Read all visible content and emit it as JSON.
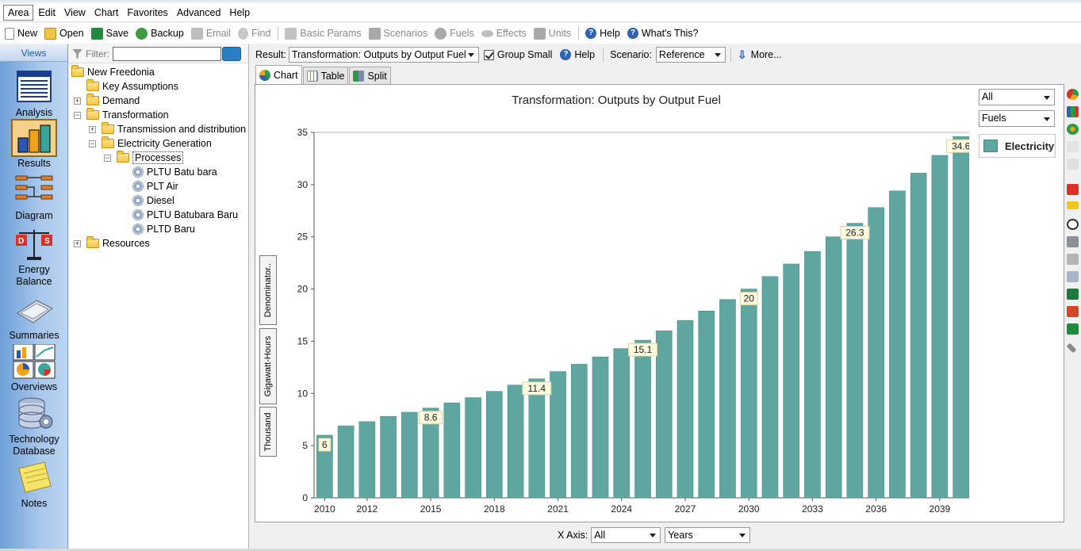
{
  "menu": [
    "Area",
    "Edit",
    "View",
    "Chart",
    "Favorites",
    "Advanced",
    "Help"
  ],
  "toolbar": {
    "new": "New",
    "open": "Open",
    "save": "Save",
    "backup": "Backup",
    "email": "Email",
    "find": "Find",
    "basic_params": "Basic Params",
    "scenarios": "Scenarios",
    "fuels": "Fuels",
    "effects": "Effects",
    "units": "Units",
    "help": "Help",
    "whats_this": "What's This?"
  },
  "views": {
    "header": "Views",
    "items": [
      "Analysis",
      "Results",
      "Diagram",
      "Energy Balance",
      "Summaries",
      "Overviews",
      "Technology Database",
      "Notes"
    ],
    "selected": "Results"
  },
  "filter": {
    "label": "Filter:",
    "value": ""
  },
  "tree": [
    {
      "label": "New Freedonia"
    },
    {
      "label": "Key Assumptions"
    },
    {
      "label": "Demand"
    },
    {
      "label": "Transformation"
    },
    {
      "label": "Transmission and distribution"
    },
    {
      "label": "Electricity Generation"
    },
    {
      "label": "Processes"
    },
    {
      "label": "PLTU Batu bara"
    },
    {
      "label": "PLT Air"
    },
    {
      "label": "Diesel"
    },
    {
      "label": "PLTU Batubara Baru"
    },
    {
      "label": "PLTD Baru"
    },
    {
      "label": "Resources"
    }
  ],
  "result_bar": {
    "result_label": "Result:",
    "result_value": "Transformation: Outputs by Output Fuel",
    "group_small": "Group Small",
    "help": "Help",
    "scenario_label": "Scenario:",
    "scenario_value": "Reference",
    "more": "More..."
  },
  "tabs": [
    "Chart",
    "Table",
    "Split"
  ],
  "side_buttons": [
    "Denominator..",
    "Gigawatt-Hours",
    "Thousand"
  ],
  "selectors": {
    "branch": "All",
    "dimension": "Fuels"
  },
  "x_axis_bar": {
    "label": "X Axis:",
    "value": "All",
    "unit": "Years"
  },
  "colors": {
    "bar": "#5fa5a0",
    "bar_stroke": "#4e928d",
    "label_bg": "#fdfbe0"
  },
  "chart_data": {
    "type": "bar",
    "title": "Transformation: Outputs by Output Fuel",
    "ylim": [
      0,
      35
    ],
    "yticks": [
      0,
      5,
      10,
      15,
      20,
      25,
      30,
      35
    ],
    "x": [
      2010,
      2011,
      2012,
      2013,
      2014,
      2015,
      2016,
      2017,
      2018,
      2019,
      2020,
      2021,
      2022,
      2023,
      2024,
      2025,
      2026,
      2027,
      2028,
      2029,
      2030,
      2031,
      2032,
      2033,
      2034,
      2035,
      2036,
      2037,
      2038,
      2039,
      2040
    ],
    "xtick_labels": [
      "2010",
      "2012",
      "2015",
      "2018",
      "2021",
      "2024",
      "2027",
      "2030",
      "2033",
      "2036",
      "2039"
    ],
    "xtick_years": [
      2010,
      2012,
      2015,
      2018,
      2021,
      2024,
      2027,
      2030,
      2033,
      2036,
      2039
    ],
    "series": [
      {
        "name": "Electricity",
        "values": [
          6.0,
          6.9,
          7.3,
          7.8,
          8.2,
          8.6,
          9.1,
          9.6,
          10.2,
          10.8,
          11.4,
          12.1,
          12.8,
          13.5,
          14.3,
          15.1,
          16.0,
          17.0,
          17.9,
          19.0,
          20.0,
          21.2,
          22.4,
          23.6,
          25.0,
          26.3,
          27.8,
          29.4,
          31.1,
          32.8,
          34.6
        ]
      }
    ],
    "data_labels": [
      {
        "year": 2010,
        "text": "6"
      },
      {
        "year": 2015,
        "text": "8.6"
      },
      {
        "year": 2020,
        "text": "11.4"
      },
      {
        "year": 2025,
        "text": "15.1"
      },
      {
        "year": 2030,
        "text": "20"
      },
      {
        "year": 2035,
        "text": "26.3"
      },
      {
        "year": 2040,
        "text": "34.6"
      }
    ],
    "legend_placement": "top-right",
    "grid": false
  }
}
